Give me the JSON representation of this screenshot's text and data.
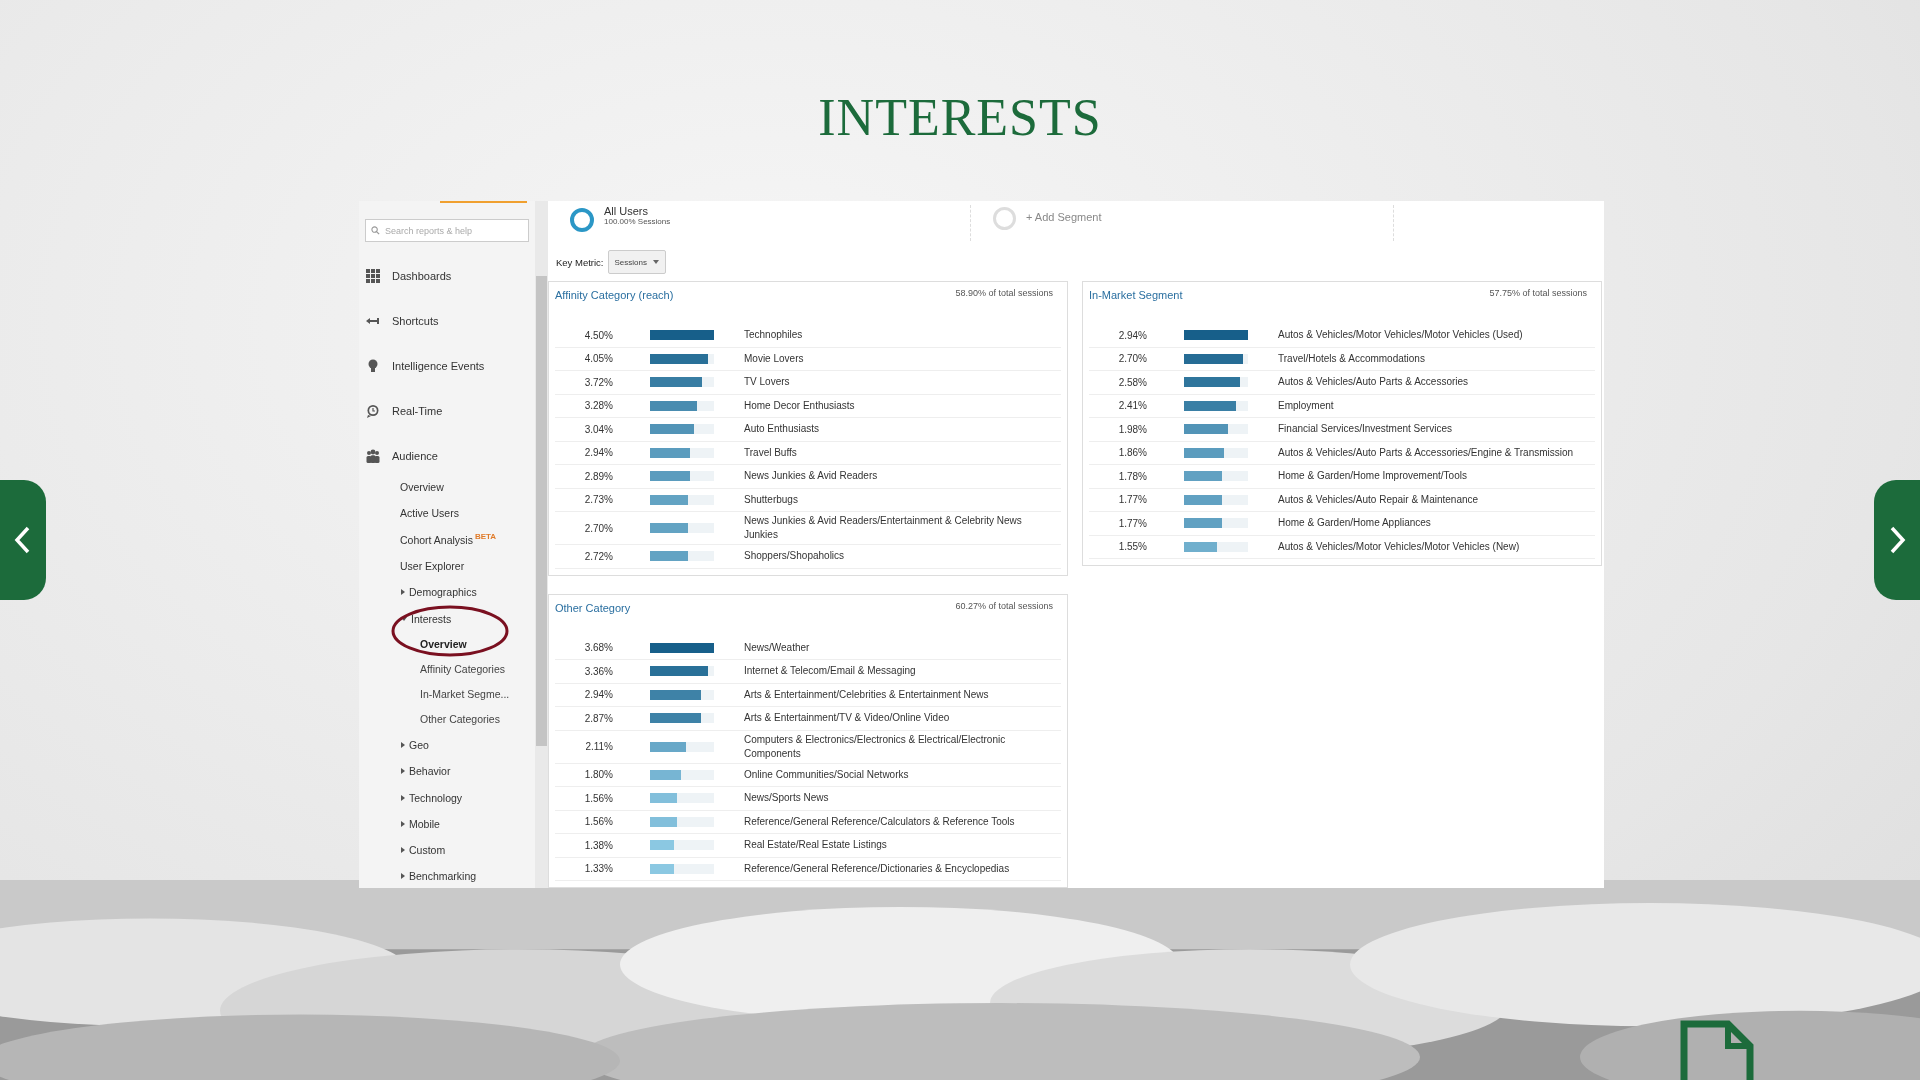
{
  "slide": {
    "title": "INTERESTS"
  },
  "search": {
    "placeholder": "Search reports & help"
  },
  "nav": [
    {
      "label": "Dashboards",
      "kind": "grid"
    },
    {
      "label": "Shortcuts",
      "kind": "arrow"
    },
    {
      "label": "Intelligence Events",
      "kind": "bulb"
    },
    {
      "label": "Real-Time",
      "kind": "clock"
    },
    {
      "label": "Audience",
      "kind": "people"
    }
  ],
  "audience_items": [
    {
      "label": "Overview",
      "kind": "link"
    },
    {
      "label": "Active Users",
      "kind": "link"
    },
    {
      "label": "Cohort Analysis",
      "kind": "link",
      "badge": "BETA"
    },
    {
      "label": "User Explorer",
      "kind": "link"
    },
    {
      "label": "Demographics",
      "kind": "group",
      "expanded": false
    },
    {
      "label": "Interests",
      "kind": "group",
      "expanded": true,
      "children": [
        {
          "label": "Overview",
          "selected": true
        },
        {
          "label": "Affinity Categories",
          "selected": false
        },
        {
          "label": "In-Market Segme...",
          "selected": false
        },
        {
          "label": "Other Categories",
          "selected": false
        }
      ]
    },
    {
      "label": "Geo",
      "kind": "group",
      "expanded": false
    },
    {
      "label": "Behavior",
      "kind": "group",
      "expanded": false
    },
    {
      "label": "Technology",
      "kind": "group",
      "expanded": false
    },
    {
      "label": "Mobile",
      "kind": "group",
      "expanded": false
    },
    {
      "label": "Custom",
      "kind": "group",
      "expanded": false
    },
    {
      "label": "Benchmarking",
      "kind": "group",
      "expanded": false
    }
  ],
  "segments": [
    {
      "kind": "segment",
      "name": "All Users",
      "detail": "100.00% Sessions"
    },
    {
      "kind": "add",
      "name": "+ Add Segment"
    }
  ],
  "key_metric": {
    "label": "Key Metric:",
    "value": "Sessions"
  },
  "panels": [
    {
      "title": "Affinity Category (reach)",
      "total": "58.90% of total sessions",
      "rows": [
        {
          "value": "4.50%",
          "level": 1,
          "name": "Technophiles"
        },
        {
          "value": "4.05%",
          "level": 0.9,
          "name": "Movie Lovers"
        },
        {
          "value": "3.72%",
          "level": 0.82,
          "name": "TV Lovers"
        },
        {
          "value": "3.28%",
          "level": 0.73,
          "name": "Home Decor Enthusiasts"
        },
        {
          "value": "3.04%",
          "level": 0.68,
          "name": "Auto Enthusiasts"
        },
        {
          "value": "2.94%",
          "level": 0.63,
          "name": "Travel Buffs"
        },
        {
          "value": "2.89%",
          "level": 0.63,
          "name": "News Junkies & Avid Readers"
        },
        {
          "value": "2.73%",
          "level": 0.59,
          "name": "Shutterbugs"
        },
        {
          "value": "2.70%",
          "level": 0.59,
          "name": "News Junkies & Avid Readers/Entertainment & Celebrity News Junkies"
        },
        {
          "value": "2.72%",
          "level": 0.59,
          "name": "Shoppers/Shopaholics"
        }
      ]
    },
    {
      "title": "In-Market Segment",
      "total": "57.75% of total sessions",
      "rows": [
        {
          "value": "2.94%",
          "level": 1,
          "name": "Autos & Vehicles/Motor Vehicles/Motor Vehicles (Used)"
        },
        {
          "value": "2.70%",
          "level": 0.92,
          "name": "Travel/Hotels & Accommodations"
        },
        {
          "value": "2.58%",
          "level": 0.87,
          "name": "Autos & Vehicles/Auto Parts & Accessories"
        },
        {
          "value": "2.41%",
          "level": 0.81,
          "name": "Employment"
        },
        {
          "value": "1.98%",
          "level": 0.68,
          "name": "Financial Services/Investment Services"
        },
        {
          "value": "1.86%",
          "level": 0.63,
          "name": "Autos & Vehicles/Auto Parts & Accessories/Engine & Transmission"
        },
        {
          "value": "1.78%",
          "level": 0.6,
          "name": "Home & Garden/Home Improvement/Tools"
        },
        {
          "value": "1.77%",
          "level": 0.6,
          "name": "Autos & Vehicles/Auto Repair & Maintenance"
        },
        {
          "value": "1.77%",
          "level": 0.6,
          "name": "Home & Garden/Home Appliances"
        },
        {
          "value": "1.55%",
          "level": 0.52,
          "name": "Autos & Vehicles/Motor Vehicles/Motor Vehicles (New)"
        }
      ]
    },
    {
      "title": "Other Category",
      "total": "60.27% of total sessions",
      "rows": [
        {
          "value": "3.68%",
          "level": 1,
          "name": "News/Weather"
        },
        {
          "value": "3.36%",
          "level": 0.9,
          "name": "Internet & Telecom/Email & Messaging"
        },
        {
          "value": "2.94%",
          "level": 0.79,
          "name": "Arts & Entertainment/Celebrities & Entertainment News"
        },
        {
          "value": "2.87%",
          "level": 0.79,
          "name": "Arts & Entertainment/TV & Video/Online Video"
        },
        {
          "value": "2.11%",
          "level": 0.56,
          "name": "Computers & Electronics/Electronics & Electrical/Electronic Components"
        },
        {
          "value": "1.80%",
          "level": 0.48,
          "name": "Online Communities/Social Networks"
        },
        {
          "value": "1.56%",
          "level": 0.42,
          "name": "News/Sports News"
        },
        {
          "value": "1.56%",
          "level": 0.42,
          "name": "Reference/General Reference/Calculators & Reference Tools"
        },
        {
          "value": "1.38%",
          "level": 0.37,
          "name": "Real Estate/Real Estate Listings"
        },
        {
          "value": "1.33%",
          "level": 0.37,
          "name": "Reference/General Reference/Dictionaries & Encyclopedias"
        }
      ]
    }
  ]
}
